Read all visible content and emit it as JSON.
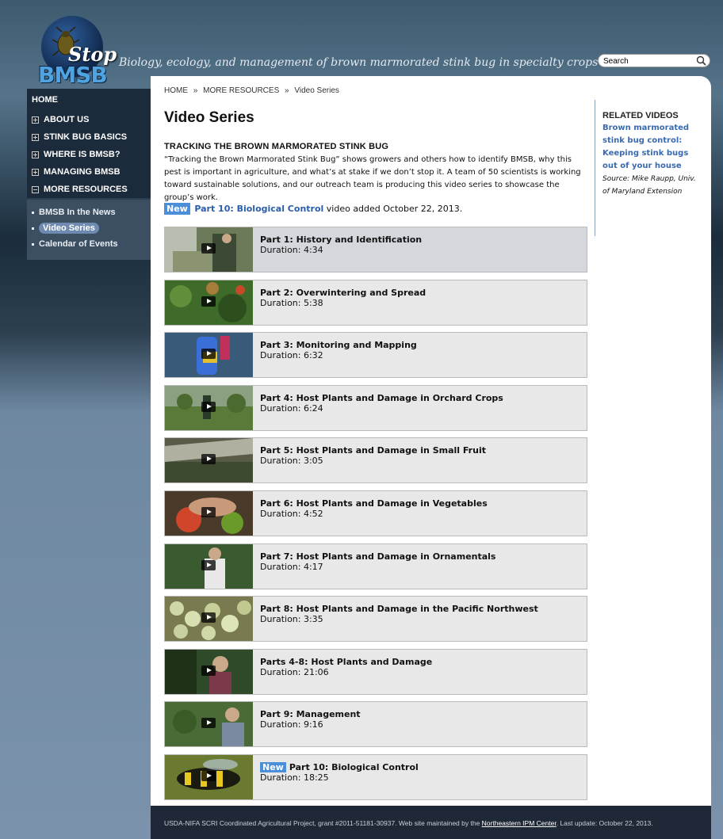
{
  "header": {
    "logo_top": "Stop",
    "logo_bottom": "BMSB",
    "tagline": "Biology, ecology, and management of brown marmorated stink bug in specialty crops",
    "search_value": "Search"
  },
  "sidebar": {
    "home": "HOME",
    "items": [
      {
        "label": "ABOUT US",
        "expanded": false
      },
      {
        "label": "STINK BUG BASICS",
        "expanded": false
      },
      {
        "label": "WHERE IS BMSB?",
        "expanded": false
      },
      {
        "label": "MANAGING BMSB",
        "expanded": false
      },
      {
        "label": "MORE RESOURCES",
        "expanded": true
      }
    ],
    "subitems": [
      {
        "label": "BMSB In the News",
        "active": false
      },
      {
        "label": "Video Series",
        "active": true
      },
      {
        "label": "Calendar of Events",
        "active": false
      }
    ]
  },
  "breadcrumb": {
    "home": "HOME",
    "sep1": "»",
    "more": "MORE RESOURCES",
    "sep2": "»",
    "current": "Video Series"
  },
  "main": {
    "title": "Video Series",
    "section_heading": "TRACKING THE BROWN MARMORATED STINK BUG",
    "intro": "“Tracking the Brown Marmorated Stink Bug” shows growers and others how to identify BMSB, why this pest is important in agriculture, and what’s at stake if we don’t stop it. A team of 50 scientists is working toward sustainable solutions, and our outreach team is producing this video series to showcase the group’s work.",
    "new_badge": "New",
    "new_link": "Part 10: Biological Control",
    "new_text": " video added October 22, 2013."
  },
  "videos": [
    {
      "title": "Part 1: History and Identification",
      "duration": "Duration: 4:34"
    },
    {
      "title": "Part 2: Overwintering and Spread",
      "duration": "Duration: 5:38"
    },
    {
      "title": "Part 3: Monitoring and Mapping",
      "duration": "Duration: 6:32"
    },
    {
      "title": "Part 4: Host Plants and Damage in Orchard Crops",
      "duration": "Duration: 6:24"
    },
    {
      "title": "Part 5: Host Plants and Damage in Small Fruit",
      "duration": "Duration: 3:05"
    },
    {
      "title": "Part 6: Host Plants and Damage in Vegetables",
      "duration": "Duration: 4:52"
    },
    {
      "title": "Part 7: Host Plants and Damage in Ornamentals",
      "duration": "Duration: 4:17"
    },
    {
      "title": "Part 8: Host Plants and Damage in the Pacific Northwest",
      "duration": "Duration: 3:35"
    },
    {
      "title": "Parts 4-8: Host Plants and Damage",
      "duration": "Duration: 21:06"
    },
    {
      "title": "Part 9: Management",
      "duration": "Duration: 9:16"
    },
    {
      "title": "Part 10: Biological Control",
      "duration": "Duration: 18:25",
      "new_label": "New"
    }
  ],
  "related": {
    "title": "RELATED VIDEOS",
    "link": "Brown marmorated stink bug control: Keeping stink bugs out of your house",
    "source": "Source: Mike Raupp, Univ. of Maryland Extension"
  },
  "footer": {
    "text_before": "USDA-NIFA SCRI Coordinated Agricultural Project, grant #2011-51181-30937. Web site maintained by the ",
    "link": "Northeastern IPM Center",
    "text_after": ". Last update: October 22, 2013."
  },
  "colors": {
    "accent": "#4a8fd8",
    "link": "#2a5ea8",
    "nav_bg": "#1c2b3b",
    "footer_bg": "#1e2836"
  }
}
